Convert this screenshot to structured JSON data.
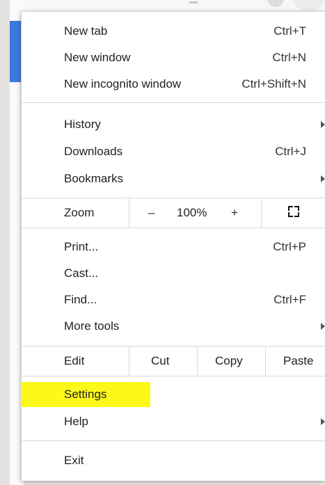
{
  "menu": {
    "new_tab": {
      "label": "New tab",
      "shortcut": "Ctrl+T"
    },
    "new_window": {
      "label": "New window",
      "shortcut": "Ctrl+N"
    },
    "new_incognito": {
      "label": "New incognito window",
      "shortcut": "Ctrl+Shift+N"
    },
    "history": {
      "label": "History"
    },
    "downloads": {
      "label": "Downloads",
      "shortcut": "Ctrl+J"
    },
    "bookmarks": {
      "label": "Bookmarks"
    },
    "zoom": {
      "label": "Zoom",
      "minus": "–",
      "value": "100%",
      "plus": "+"
    },
    "print": {
      "label": "Print...",
      "shortcut": "Ctrl+P"
    },
    "cast": {
      "label": "Cast..."
    },
    "find": {
      "label": "Find...",
      "shortcut": "Ctrl+F"
    },
    "more_tools": {
      "label": "More tools"
    },
    "edit": {
      "label": "Edit",
      "cut": "Cut",
      "copy": "Copy",
      "paste": "Paste"
    },
    "settings": {
      "label": "Settings"
    },
    "help": {
      "label": "Help"
    },
    "exit": {
      "label": "Exit"
    }
  },
  "colors": {
    "highlight": "#fcf81a",
    "accent_blue": "#3f78dd"
  },
  "icons": {
    "fullscreen": "fullscreen-icon",
    "submenu": "chevron-right-icon"
  }
}
